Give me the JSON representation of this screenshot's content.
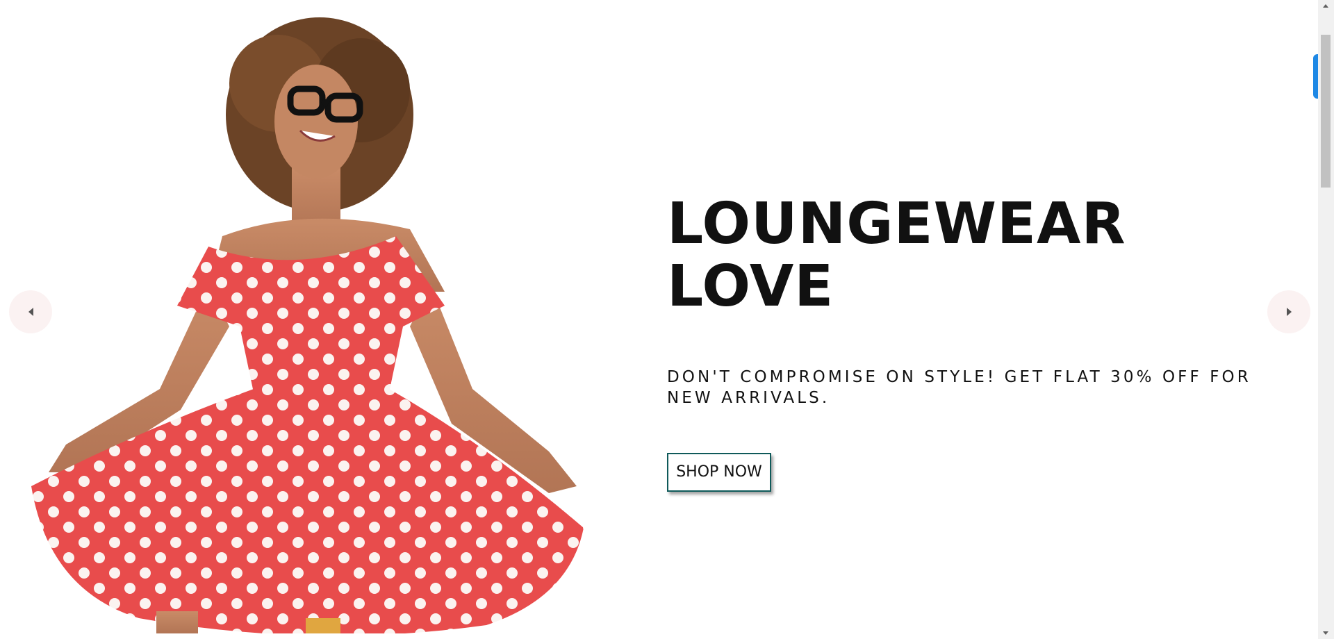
{
  "slide": {
    "title": "LOUNGEWEAR LOVE",
    "subtitle": "DON'T COMPROMISE ON STYLE! GET FLAT 30% OFF FOR NEW ARRIVALS.",
    "cta_label": "SHOP NOW"
  },
  "carousel": {
    "prev_icon": "caret-left-icon",
    "next_icon": "caret-right-icon"
  },
  "colors": {
    "dress": "#e84c4c",
    "dots": "#ffffff",
    "button_border": "#0f5a5a",
    "side_tab": "#1e88e5"
  }
}
